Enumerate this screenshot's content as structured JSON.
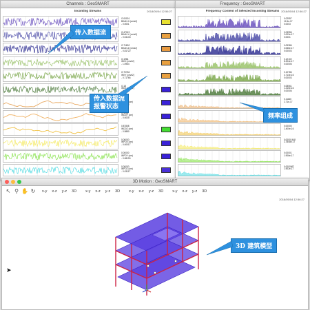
{
  "channels_window": {
    "title": "Channels : GeoSMART",
    "panel_title": "Incoming Streams",
    "timestamp": "2018/05/04 12:56:27",
    "rows": [
      {
        "id": "G.00001",
        "name": "BKAN.X (cm/s2)",
        "val": "- 0.0001",
        "color": "#5b3fb8",
        "swatch": "#e8e030"
      },
      {
        "id": "G.47019",
        "name": "BKAN.Y (cm/s2)",
        "val": "- 0.04133",
        "color": "#3a3a9f",
        "swatch": "#e8a040"
      },
      {
        "id": "G.71802",
        "name": "BKAN.Z (cm/s2)",
        "val": "- 0.81722",
        "color": "#1b1b88",
        "swatch": "#e89a40"
      },
      {
        "id": "G.1964",
        "name": "INKX (cm/s2)",
        "val": "- 1.0964",
        "color": "#8fbc5a",
        "swatch": "#e8a040"
      },
      {
        "id": "G.70766",
        "name": "INKY (cm/s2)",
        "val": "- 0.71766",
        "color": "#6f9f3a",
        "swatch": "#e8a040"
      },
      {
        "id": "G.18",
        "name": "INKZ (cm/s2)",
        "val": "- 0.1825",
        "color": "#3d6f2a",
        "swatch": "#3a22d8"
      },
      {
        "id": "G.60",
        "name": "INDDX (cm)",
        "val": "- 0.0000",
        "color": "#e8a860",
        "swatch": "#3a22d8"
      },
      {
        "id": "G.1964",
        "name": "INDDY (cm)",
        "val": "- 0.0035",
        "color": "#f0b060",
        "swatch": "#3a22d8"
      },
      {
        "id": "0.87808",
        "name": "INDDZ (cm)",
        "val": "- 0.5880",
        "color": "#f0c040",
        "swatch": "#44dd33"
      },
      {
        "id": "0.00000",
        "name": "INPDX (cm)",
        "val": "- 0.00017",
        "color": "#f4e850",
        "swatch": "#3a22d8"
      },
      {
        "id": "0.00000",
        "name": "INPDY (cm)",
        "val": "- 0.08190",
        "color": "#7ce03a",
        "swatch": "#3a22d8"
      },
      {
        "id": "0.00000",
        "name": "INPDZ (cm)",
        "val": "- 0.03117",
        "color": "#40d8e0",
        "swatch": "#4a30d8"
      }
    ]
  },
  "frequency_window": {
    "title": "Frequency : GeoSMART",
    "panel_title": "Frequency Content of Selected Incoming Streams",
    "timestamp": "2018/05/04 12:56:27",
    "rows": [
      {
        "lines": "0.02957\n12.4e-17\n0.0003",
        "color": "#5b3fb8"
      },
      {
        "lines": "0.03956\n2.002e-17\n0.0001",
        "color": "#3a3a9f"
      },
      {
        "lines": "0.09386\n3.066e-17\n0.00003",
        "color": "#1b1b88"
      },
      {
        "lines": "0.12102\n8.204e-17\n0.00006",
        "color": "#8fbc5a"
      },
      {
        "lines": "0.10786\n4.714e-16\n0.00003",
        "color": "#6f9f3a"
      },
      {
        "lines": "0.08061\n1.210e-16\n0.00006",
        "color": "#3d6f2a"
      },
      {
        "lines": "0.11160\n2.71e-17",
        "color": "#e8a860"
      },
      {
        "lines": "0.00000\n2.400e-16",
        "color": "#f0b060"
      },
      {
        "lines": "0.00000\n2.400e-16",
        "color": "#f0c040"
      },
      {
        "lines": "0.00001448\n2.7808e-17",
        "color": "#f4e850"
      },
      {
        "lines": "0.00001\n1.906e-17",
        "color": "#7ce03a"
      },
      {
        "lines": "0.0000067\n1.902e-17",
        "color": "#40d8e0"
      }
    ],
    "x_ticks": [
      "0",
      "1",
      "5",
      "10",
      "15"
    ]
  },
  "motion_window": {
    "title": "3D Motion : GeoSMART",
    "timestamp": "2018/05/04 12:56:27",
    "toolbar": [
      "x-y",
      "x-z",
      "y-z",
      "3D",
      "x-y",
      "x-z",
      "y-z",
      "3D",
      "x-y",
      "x-z",
      "y-z",
      "3D",
      "x-y",
      "x-z",
      "y-z",
      "3D"
    ]
  },
  "callouts": {
    "incoming": "传入数据流",
    "alarm_line1": "传入数据流",
    "alarm_line2": "报警状态",
    "frequency": "频率组成",
    "building": "3D 建筑模型"
  },
  "colors": {
    "accent": "#2e91df",
    "floor": "#5a3fe0",
    "column": "#cc2244"
  }
}
